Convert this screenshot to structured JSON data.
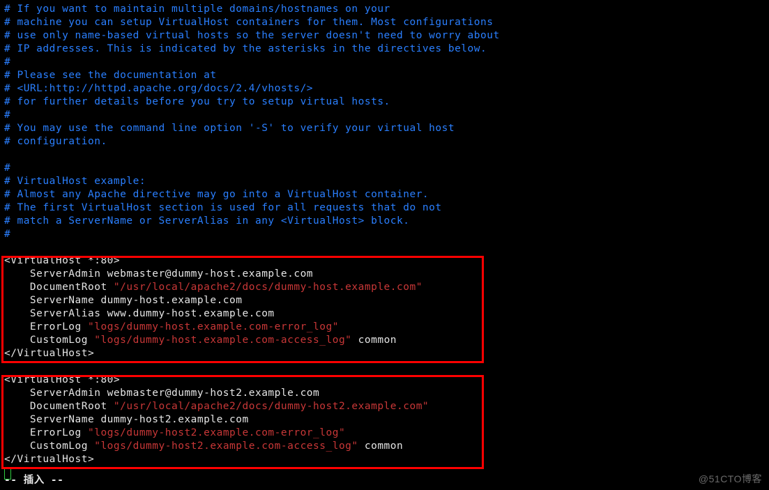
{
  "lines": [
    {
      "cls": "comment",
      "text": "# If you want to maintain multiple domains/hostnames on your"
    },
    {
      "cls": "comment",
      "text": "# machine you can setup VirtualHost containers for them. Most configurations"
    },
    {
      "cls": "comment",
      "text": "# use only name-based virtual hosts so the server doesn't need to worry about"
    },
    {
      "cls": "comment",
      "text": "# IP addresses. This is indicated by the asterisks in the directives below."
    },
    {
      "cls": "comment",
      "text": "#"
    },
    {
      "cls": "comment",
      "text": "# Please see the documentation at"
    },
    {
      "cls": "comment",
      "text": "# <URL:http://httpd.apache.org/docs/2.4/vhosts/>"
    },
    {
      "cls": "comment",
      "text": "# for further details before you try to setup virtual hosts."
    },
    {
      "cls": "comment",
      "text": "#"
    },
    {
      "cls": "comment",
      "text": "# You may use the command line option '-S' to verify your virtual host"
    },
    {
      "cls": "comment",
      "text": "# configuration."
    },
    {
      "cls": "comment",
      "text": ""
    },
    {
      "cls": "comment",
      "text": "#"
    },
    {
      "cls": "comment",
      "text": "# VirtualHost example:"
    },
    {
      "cls": "comment",
      "text": "# Almost any Apache directive may go into a VirtualHost container."
    },
    {
      "cls": "comment",
      "text": "# The first VirtualHost section is used for all requests that do not"
    },
    {
      "cls": "comment",
      "text": "# match a ServerName or ServerAlias in any <VirtualHost> block."
    },
    {
      "cls": "comment",
      "text": "#"
    },
    {
      "cls": "directive",
      "text": ""
    },
    {
      "cls": "directive",
      "text": "<VirtualHost *:80>"
    },
    {
      "cls": "directive",
      "text": "    ServerAdmin webmaster@dummy-host.example.com"
    },
    {
      "cls": "mixed",
      "pre": "    DocumentRoot ",
      "str": "\"/usr/local/apache2/docs/dummy-host.example.com\"",
      "post": ""
    },
    {
      "cls": "directive",
      "text": "    ServerName dummy-host.example.com"
    },
    {
      "cls": "directive",
      "text": "    ServerAlias www.dummy-host.example.com"
    },
    {
      "cls": "mixed",
      "pre": "    ErrorLog ",
      "str": "\"logs/dummy-host.example.com-error_log\"",
      "post": ""
    },
    {
      "cls": "mixed",
      "pre": "    CustomLog ",
      "str": "\"logs/dummy-host.example.com-access_log\"",
      "post": " common"
    },
    {
      "cls": "directive",
      "text": "</VirtualHost>"
    },
    {
      "cls": "directive",
      "text": ""
    },
    {
      "cls": "directive",
      "text": "<VirtualHost *:80>"
    },
    {
      "cls": "directive",
      "text": "    ServerAdmin webmaster@dummy-host2.example.com"
    },
    {
      "cls": "mixed",
      "pre": "    DocumentRoot ",
      "str": "\"/usr/local/apache2/docs/dummy-host2.example.com\"",
      "post": ""
    },
    {
      "cls": "directive",
      "text": "    ServerName dummy-host2.example.com"
    },
    {
      "cls": "mixed",
      "pre": "    ErrorLog ",
      "str": "\"logs/dummy-host2.example.com-error_log\"",
      "post": ""
    },
    {
      "cls": "mixed",
      "pre": "    CustomLog ",
      "str": "\"logs/dummy-host2.example.com-access_log\"",
      "post": " common"
    },
    {
      "cls": "directive",
      "text": "</VirtualHost>"
    }
  ],
  "status": "-- 插入 --",
  "watermark": "@51CTO博客"
}
